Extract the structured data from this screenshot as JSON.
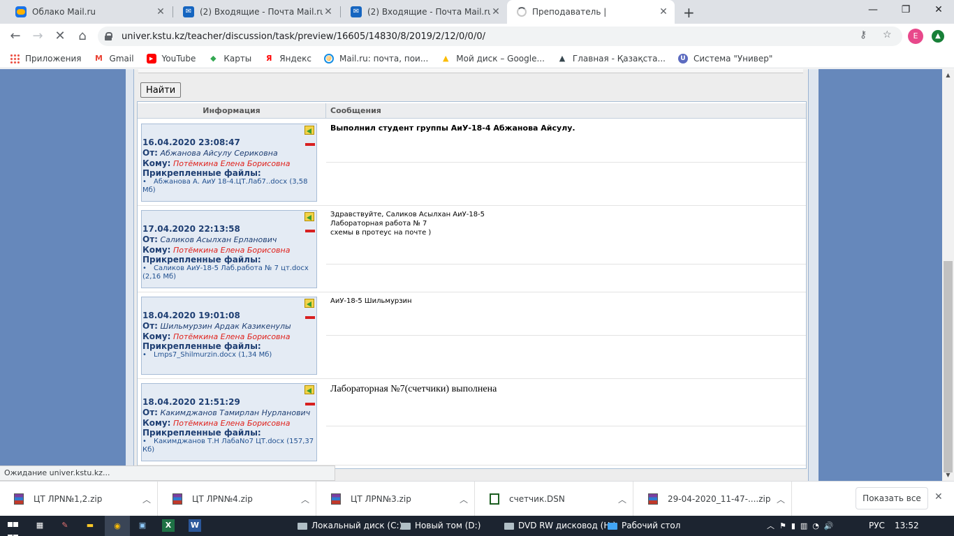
{
  "browser": {
    "tabs": [
      {
        "title": "Облако Mail.ru",
        "icon": "cloud-icon",
        "active": false
      },
      {
        "title": "(2) Входящие - Почта Mail.ru",
        "icon": "mail-icon",
        "active": false
      },
      {
        "title": "(2) Входящие - Почта Mail.ru",
        "icon": "mail-icon",
        "active": false
      },
      {
        "title": "Преподаватель |",
        "icon": "loading-spinner-icon",
        "active": true
      }
    ],
    "url": "univer.kstu.kz/teacher/discussion/task/preview/16605/14830/8/2019/2/12/0/0/0/",
    "profile_initial": "E",
    "bookmarks": [
      {
        "label": "Приложения",
        "icon": "apps-icon"
      },
      {
        "label": "Gmail",
        "icon": "gmail-icon"
      },
      {
        "label": "YouTube",
        "icon": "youtube-icon"
      },
      {
        "label": "Карты",
        "icon": "maps-icon"
      },
      {
        "label": "Яндекс",
        "icon": "yandex-icon"
      },
      {
        "label": "Mail.ru: почта, пои...",
        "icon": "mailru-icon"
      },
      {
        "label": "Мой диск – Google...",
        "icon": "google-drive-icon"
      },
      {
        "label": "Главная - Қазақста...",
        "icon": "kz-portal-icon"
      },
      {
        "label": "Система \"Универ\"",
        "icon": "univer-icon"
      }
    ],
    "status_text": "Ожидание univer.kstu.kz..."
  },
  "page": {
    "find_button": "Найти",
    "table_headers": {
      "info": "Информация",
      "messages": "Сообщения"
    },
    "rows": [
      {
        "date": "16.04.2020 23:08:47",
        "from_label": "От:",
        "from": "Абжанова Айсулу Сериковна",
        "to_label": "Кому:",
        "to": "Потёмкина Елена Борисовна",
        "files_label": "Прикрепленные файлы:",
        "files": [
          "Абжанова А. АиУ 18-4.ЦТ.Лаб7..docx (3,58 Мб)"
        ],
        "message": "Выполнил студент группы АиУ-18-4 Абжанова Айсулу.",
        "style": "bold"
      },
      {
        "date": "17.04.2020 22:13:58",
        "from_label": "От:",
        "from": "Саликов Асылхан Ерланович",
        "to_label": "Кому:",
        "to": "Потёмкина Елена Борисовна",
        "files_label": "Прикрепленные файлы:",
        "files": [
          "Саликов АиУ-18-5 Лаб.работа № 7 цт.docx (2,16 Мб)"
        ],
        "message": "Здравствуйте, Саликов Асылхан АиУ-18-5\nЛабораторная работа № 7\nсхемы в протеус на почте )",
        "style": "normal"
      },
      {
        "date": "18.04.2020 19:01:08",
        "from_label": "От:",
        "from": "Шильмурзин Ардак Казикенулы",
        "to_label": "Кому:",
        "to": "Потёмкина Елена Борисовна",
        "files_label": "Прикрепленные файлы:",
        "files": [
          "Lmps7_Shilmurzin.docx (1,34 Мб)"
        ],
        "message": "АиУ-18-5 Шильмурзин",
        "style": "normal"
      },
      {
        "date": "18.04.2020 21:51:29",
        "from_label": "От:",
        "from": "Какимджанов Тамирлан Нурланович",
        "to_label": "Кому:",
        "to": "Потёмкина Елена Борисовна",
        "files_label": "Прикрепленные файлы:",
        "files": [
          "Какимджанов Т.Н ЛабаNo7 ЦТ.docx (157,37 Кб)"
        ],
        "message": "Лабораторная №7(счетчики) выполнена",
        "style": "serif"
      }
    ]
  },
  "downloads": {
    "items": [
      {
        "name": "ЦТ ЛРN№1,2.zip",
        "icon": "winrar-archive-icon"
      },
      {
        "name": "ЦТ ЛРN№4.zip",
        "icon": "winrar-archive-icon"
      },
      {
        "name": "ЦТ ЛРN№3.zip",
        "icon": "winrar-archive-icon"
      },
      {
        "name": "счетчик.DSN",
        "icon": "dsn-file-icon"
      },
      {
        "name": "29-04-2020_11-47-....zip",
        "icon": "winrar-archive-icon"
      }
    ],
    "show_all": "Показать все"
  },
  "taskbar": {
    "drives": [
      "Локальный диск (C:)",
      "Новый том (D:)",
      "DVD RW дисковод (H:)",
      "Рабочий стол"
    ],
    "lang": "РУС",
    "time": "13:52"
  },
  "colors": {
    "page_background": "#6688bb",
    "recipient_red": "#e0201a",
    "info_blue": "#1f3f73"
  }
}
